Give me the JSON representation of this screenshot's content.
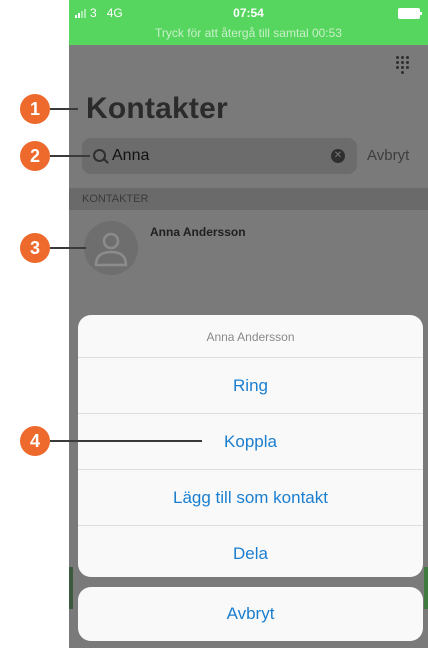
{
  "status_bar": {
    "carrier": "3",
    "network": "4G",
    "time": "07:54",
    "return_to_call": "Tryck för att återgå till samtal 00:53"
  },
  "header": {
    "title": "Kontakter"
  },
  "search": {
    "value": "Anna",
    "cancel_label": "Avbryt"
  },
  "section": {
    "header": "KONTAKTER"
  },
  "contact": {
    "name": "Anna Andersson"
  },
  "action_sheet": {
    "title": "Anna Andersson",
    "actions": [
      "Ring",
      "Koppla",
      "Lägg till som kontakt",
      "Dela"
    ],
    "cancel_label": "Avbryt"
  },
  "callouts": [
    "1",
    "2",
    "3",
    "4"
  ],
  "colors": {
    "status_bar": "#57d65f",
    "callout": "#ed6a2c",
    "action_text": "#1a7ed0"
  }
}
